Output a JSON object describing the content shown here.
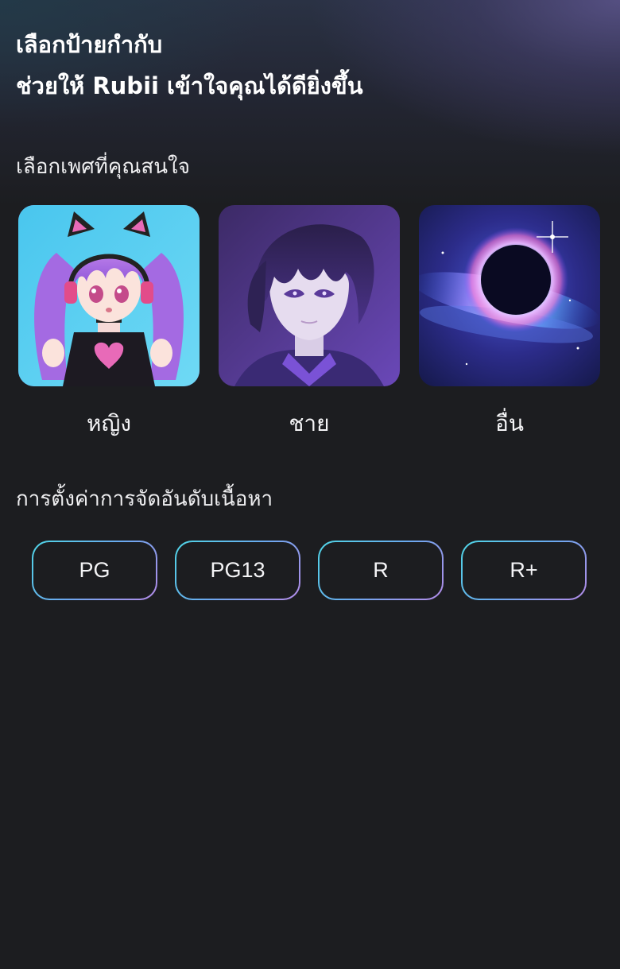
{
  "header": {
    "title_line1": "เลือกป้ายกำกับ",
    "title_line2": "ช่วยให้ Rubii เข้าใจคุณได้ดียิ่งขึ้น"
  },
  "gender_section": {
    "label": "เลือกเพศที่คุณสนใจ",
    "options": [
      {
        "label": "หญิง",
        "image_icon": "anime-girl-avatar"
      },
      {
        "label": "ชาย",
        "image_icon": "anime-boy-avatar"
      },
      {
        "label": "อื่น",
        "image_icon": "black-hole-galaxy"
      }
    ]
  },
  "rating_section": {
    "label": "การตั้งค่าการจัดอันดับเนื้อหา",
    "options": [
      "PG",
      "PG13",
      "R",
      "R+"
    ]
  },
  "colors": {
    "background": "#1c1d20",
    "pill_border_gradient": [
      "#4fd6e6",
      "#b58be8"
    ]
  }
}
